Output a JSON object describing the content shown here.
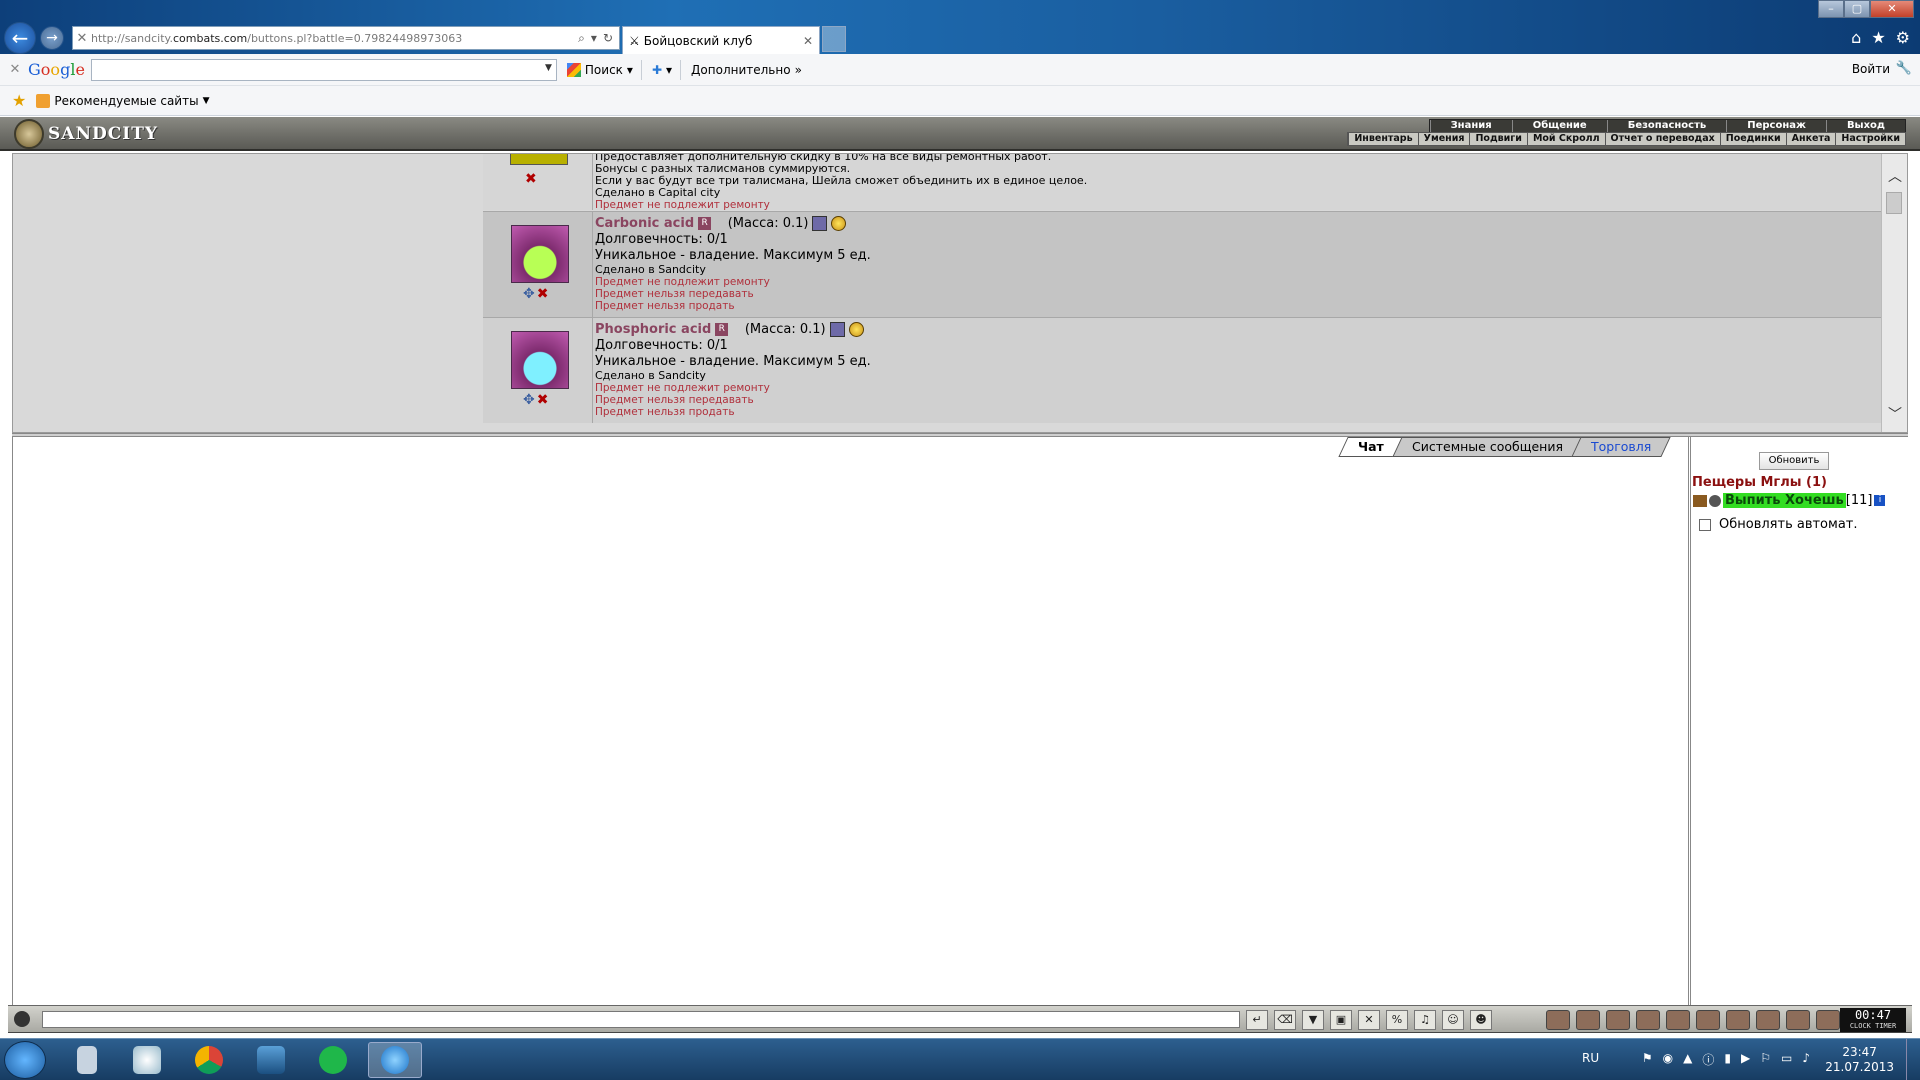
{
  "browser": {
    "url_prefix": "http://sandcity.",
    "url_domain": "combats.com",
    "url_suffix": "/buttons.pl?battle=0.79824498973063",
    "tab_title": "Бойцовский клуб",
    "window_controls": {
      "minimize": "–",
      "maximize": "▢",
      "close": "✕"
    },
    "nav_icons": [
      "home-icon",
      "favorites-star-icon",
      "gear-icon"
    ]
  },
  "google_toolbar": {
    "logo": [
      "G",
      "o",
      "o",
      "g",
      "l",
      "e"
    ],
    "search_value": "",
    "search_button": "Поиск",
    "more_button": "Дополнительно",
    "signin": "Войти"
  },
  "favorites_bar": {
    "recommended": "Рекомендуемые сайты"
  },
  "game": {
    "logo_text": "SANDCITY",
    "menu_top": [
      "Знания",
      "Общение",
      "Безопасность",
      "Персонаж",
      "Выход"
    ],
    "menu_bottom": [
      "Инвентарь",
      "Умения",
      "Подвиги",
      "Мой Скролл",
      "Отчет о переводах",
      "Поединки",
      "Анкета",
      "Настройки"
    ]
  },
  "inventory": {
    "prev_item": {
      "lines_small": [
        "Предоставляет дополнительную скидку в 10% на все виды ремонтных работ.",
        "Бонусы с разных талисманов суммируются.",
        "Если у вас будут все три талисмана, Шейла сможет объединить их в единое целое.",
        "Сделано в Capital city"
      ],
      "lines_red": [
        "Предмет не подлежит ремонту"
      ]
    },
    "items": [
      {
        "name": "Carbonic acid",
        "badge": "R",
        "mass": "(Масса: 0.1)",
        "durability": "Долговечность: 0/1",
        "unique": "Уникальное - владение. Максимум 5 ед.",
        "made_in": "Сделано в Sandcity",
        "notes": [
          "Предмет не подлежит ремонту",
          "Предмет нельзя передавать",
          "Предмет нельзя продать"
        ]
      },
      {
        "name": "Phosphoric acid",
        "badge": "R",
        "mass": "(Масса: 0.1)",
        "durability": "Долговечность: 0/1",
        "unique": "Уникальное - владение. Максимум 5 ед.",
        "made_in": "Сделано в Sandcity",
        "notes": [
          "Предмет не подлежит ремонту",
          "Предмет нельзя передавать",
          "Предмет нельзя продать"
        ]
      }
    ]
  },
  "chat": {
    "tabs": [
      "Чат",
      "Системные сообщения",
      "Торговля"
    ],
    "input_value": ""
  },
  "online": {
    "refresh_button": "Обновить",
    "room": "Пещеры Мглы (1)",
    "player_nick": "Выпить Хочешь",
    "player_level": "[11]",
    "info_badge": "i",
    "auto_refresh_label": "Обновлять автомат."
  },
  "bottom_bar": {
    "clock_time": "00:47",
    "clock_label": "CLOCK TIMER"
  },
  "taskbar": {
    "language": "RU",
    "time": "23:47",
    "date": "21.07.2013"
  },
  "colors": {
    "item_name": "#8a4560",
    "red_note": "#b0303c",
    "room_title": "#8b1010",
    "player_highlight": "#33dd22",
    "trade_tab": "#1a4ad1"
  }
}
